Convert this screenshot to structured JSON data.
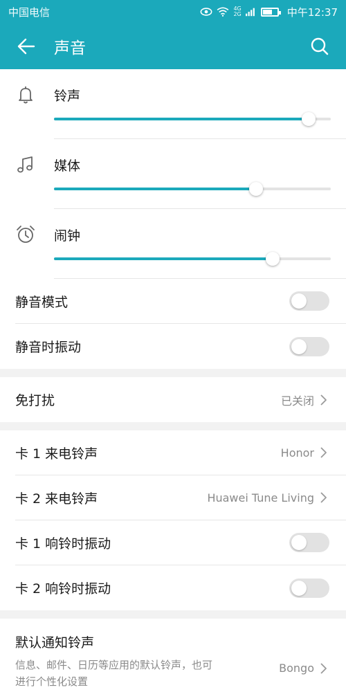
{
  "status_bar": {
    "carrier": "中国电信",
    "network_top": "4G",
    "network_bottom": "2G",
    "time": "中午12:37"
  },
  "header": {
    "title": "声音"
  },
  "volumes": [
    {
      "label": "铃声",
      "level": 0.92
    },
    {
      "label": "媒体",
      "level": 0.73
    },
    {
      "label": "闹钟",
      "level": 0.79
    }
  ],
  "toggles_group1": [
    {
      "label": "静音模式",
      "on": false
    },
    {
      "label": "静音时振动",
      "on": false
    }
  ],
  "dnd": {
    "label": "免打扰",
    "value": "已关闭"
  },
  "sim_ringtones": [
    {
      "label": "卡 1 来电铃声",
      "value": "Honor"
    },
    {
      "label": "卡 2 来电铃声",
      "value": "Huawei Tune Living"
    }
  ],
  "sim_vibrate": [
    {
      "label": "卡 1 响铃时振动",
      "on": false
    },
    {
      "label": "卡 2 响铃时振动",
      "on": false
    }
  ],
  "notification": {
    "title": "默认通知铃声",
    "subtitle": "信息、邮件、日历等应用的默认铃声，也可进行个性化设置",
    "value": "Bongo"
  },
  "colors": {
    "accent": "#1ba9bb",
    "toggle_off": "#e2e2e2"
  }
}
